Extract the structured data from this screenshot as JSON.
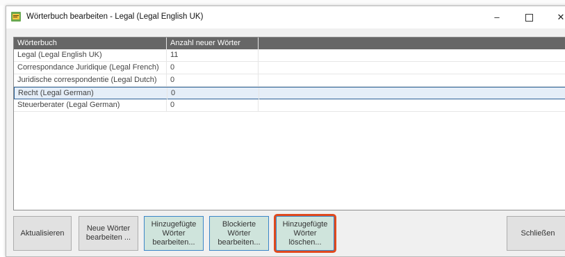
{
  "window": {
    "title": "Wörterbuch bearbeiten - Legal (Legal English UK)",
    "controls": {
      "minimize": "–",
      "maximize": "",
      "close": "✕"
    }
  },
  "table": {
    "headers": [
      "Wörterbuch",
      "Anzahl neuer Wörter"
    ],
    "rows": [
      {
        "name": "Legal (Legal English UK)",
        "count": "11"
      },
      {
        "name": "Correspondance Juridique (Legal French)",
        "count": "0"
      },
      {
        "name": "Juridische correspondentie (Legal Dutch)",
        "count": "0"
      },
      {
        "name": "Recht (Legal German)",
        "count": "0"
      },
      {
        "name": "Steuerberater (Legal German)",
        "count": "0"
      }
    ],
    "selected_row_index": 3
  },
  "buttons": {
    "refresh": "Aktualisieren",
    "edit_new_words": "Neue Wörter bearbeiten ...",
    "edit_added_words": "Hinzugefügte Wörter bearbeiten...",
    "edit_blocked_words": "Blockierte Wörter bearbeiten...",
    "delete_added_words": "Hinzugefügte Wörter löschen...",
    "close": "Schließen"
  },
  "colors": {
    "header_bg": "#666666",
    "accent_button_bg": "#cfe4dc",
    "accent_button_border": "#3b86c8",
    "highlight_outline": "#e04a1e",
    "selection_bg": "#e5eef8",
    "icon": "book-edit-icon"
  }
}
